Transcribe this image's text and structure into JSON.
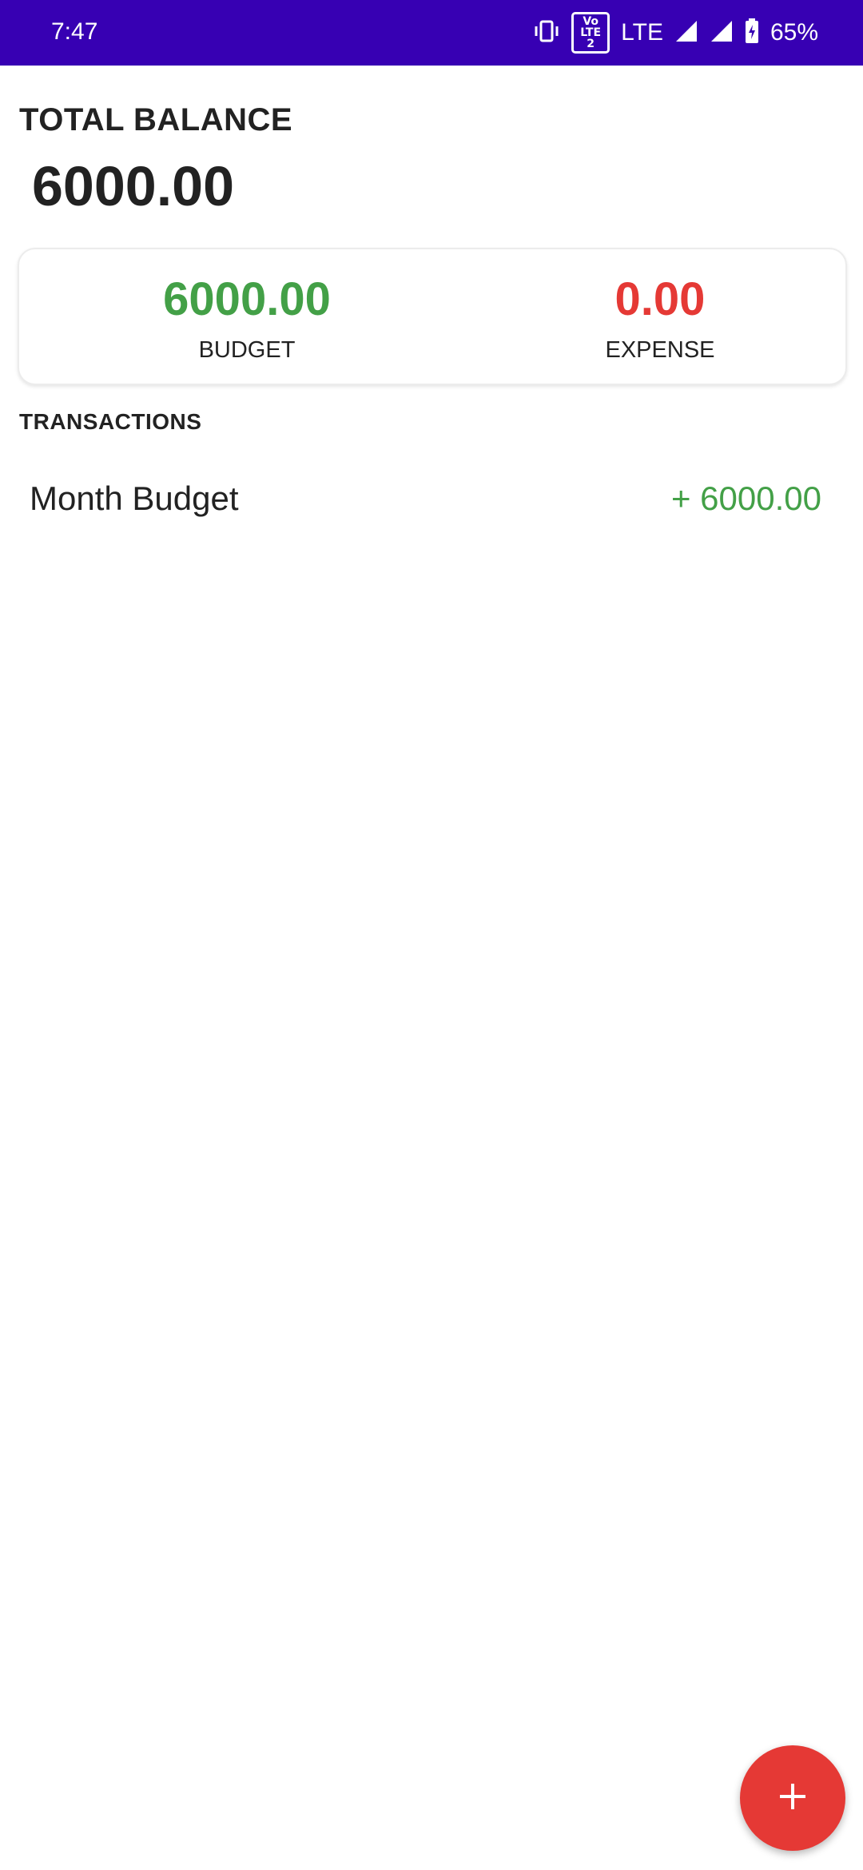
{
  "status_bar": {
    "time": "7:47",
    "volte": "Vo LTE 2",
    "network": "LTE",
    "battery": "65%"
  },
  "balance": {
    "label": "TOTAL BALANCE",
    "amount": "6000.00"
  },
  "summary": {
    "budget_value": "6000.00",
    "budget_label": "BUDGET",
    "expense_value": "0.00",
    "expense_label": "EXPENSE"
  },
  "transactions": {
    "title": "TRANSACTIONS",
    "items": [
      {
        "name": "Month Budget",
        "amount": "+ 6000.00"
      }
    ]
  },
  "fab": {
    "icon": "plus-icon"
  },
  "colors": {
    "status_bar": "#3700b3",
    "positive": "#43a047",
    "negative": "#e53935",
    "fab": "#e53935"
  }
}
